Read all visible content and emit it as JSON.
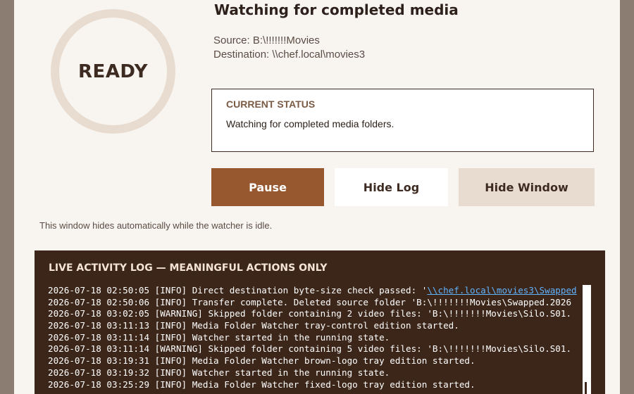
{
  "status_ring": {
    "label": "READY"
  },
  "header": {
    "title": "Watching for completed media",
    "source": "Source: B:\\!!!!!!!Movies",
    "destination": "Destination: \\\\chef.local\\movies3"
  },
  "current_status": {
    "title": "CURRENT STATUS",
    "text": "Watching for completed media folders."
  },
  "buttons": {
    "pause": "Pause",
    "hide_log": "Hide Log",
    "hide_window": "Hide Window"
  },
  "auto_hide_note": "This window hides automatically while the watcher is idle.",
  "log": {
    "title": "LIVE ACTIVITY LOG — MEANINGFUL ACTIONS ONLY",
    "line0_prefix": "2026-07-18 02:50:05 [INFO] Direct destination byte-size check passed: '",
    "line0_link": "\\\\chef.local\\movies3\\Swapped",
    "lines": [
      "2026-07-18 02:50:06 [INFO] Transfer complete. Deleted source folder 'B:\\!!!!!!!Movies\\Swapped.2026",
      "2026-07-18 03:02:05 [WARNING] Skipped folder containing 2 video files: 'B:\\!!!!!!!Movies\\Silo.S01.",
      "2026-07-18 03:11:13 [INFO] Media Folder Watcher tray-control edition started.",
      "2026-07-18 03:11:14 [INFO] Watcher started in the running state.",
      "2026-07-18 03:11:14 [WARNING] Skipped folder containing 5 video files: 'B:\\!!!!!!!Movies\\Silo.S01.",
      "2026-07-18 03:19:31 [INFO] Media Folder Watcher brown-logo tray edition started.",
      "2026-07-18 03:19:32 [INFO] Watcher started in the running state.",
      "2026-07-18 03:25:29 [INFO] Media Folder Watcher fixed-logo tray edition started."
    ]
  }
}
